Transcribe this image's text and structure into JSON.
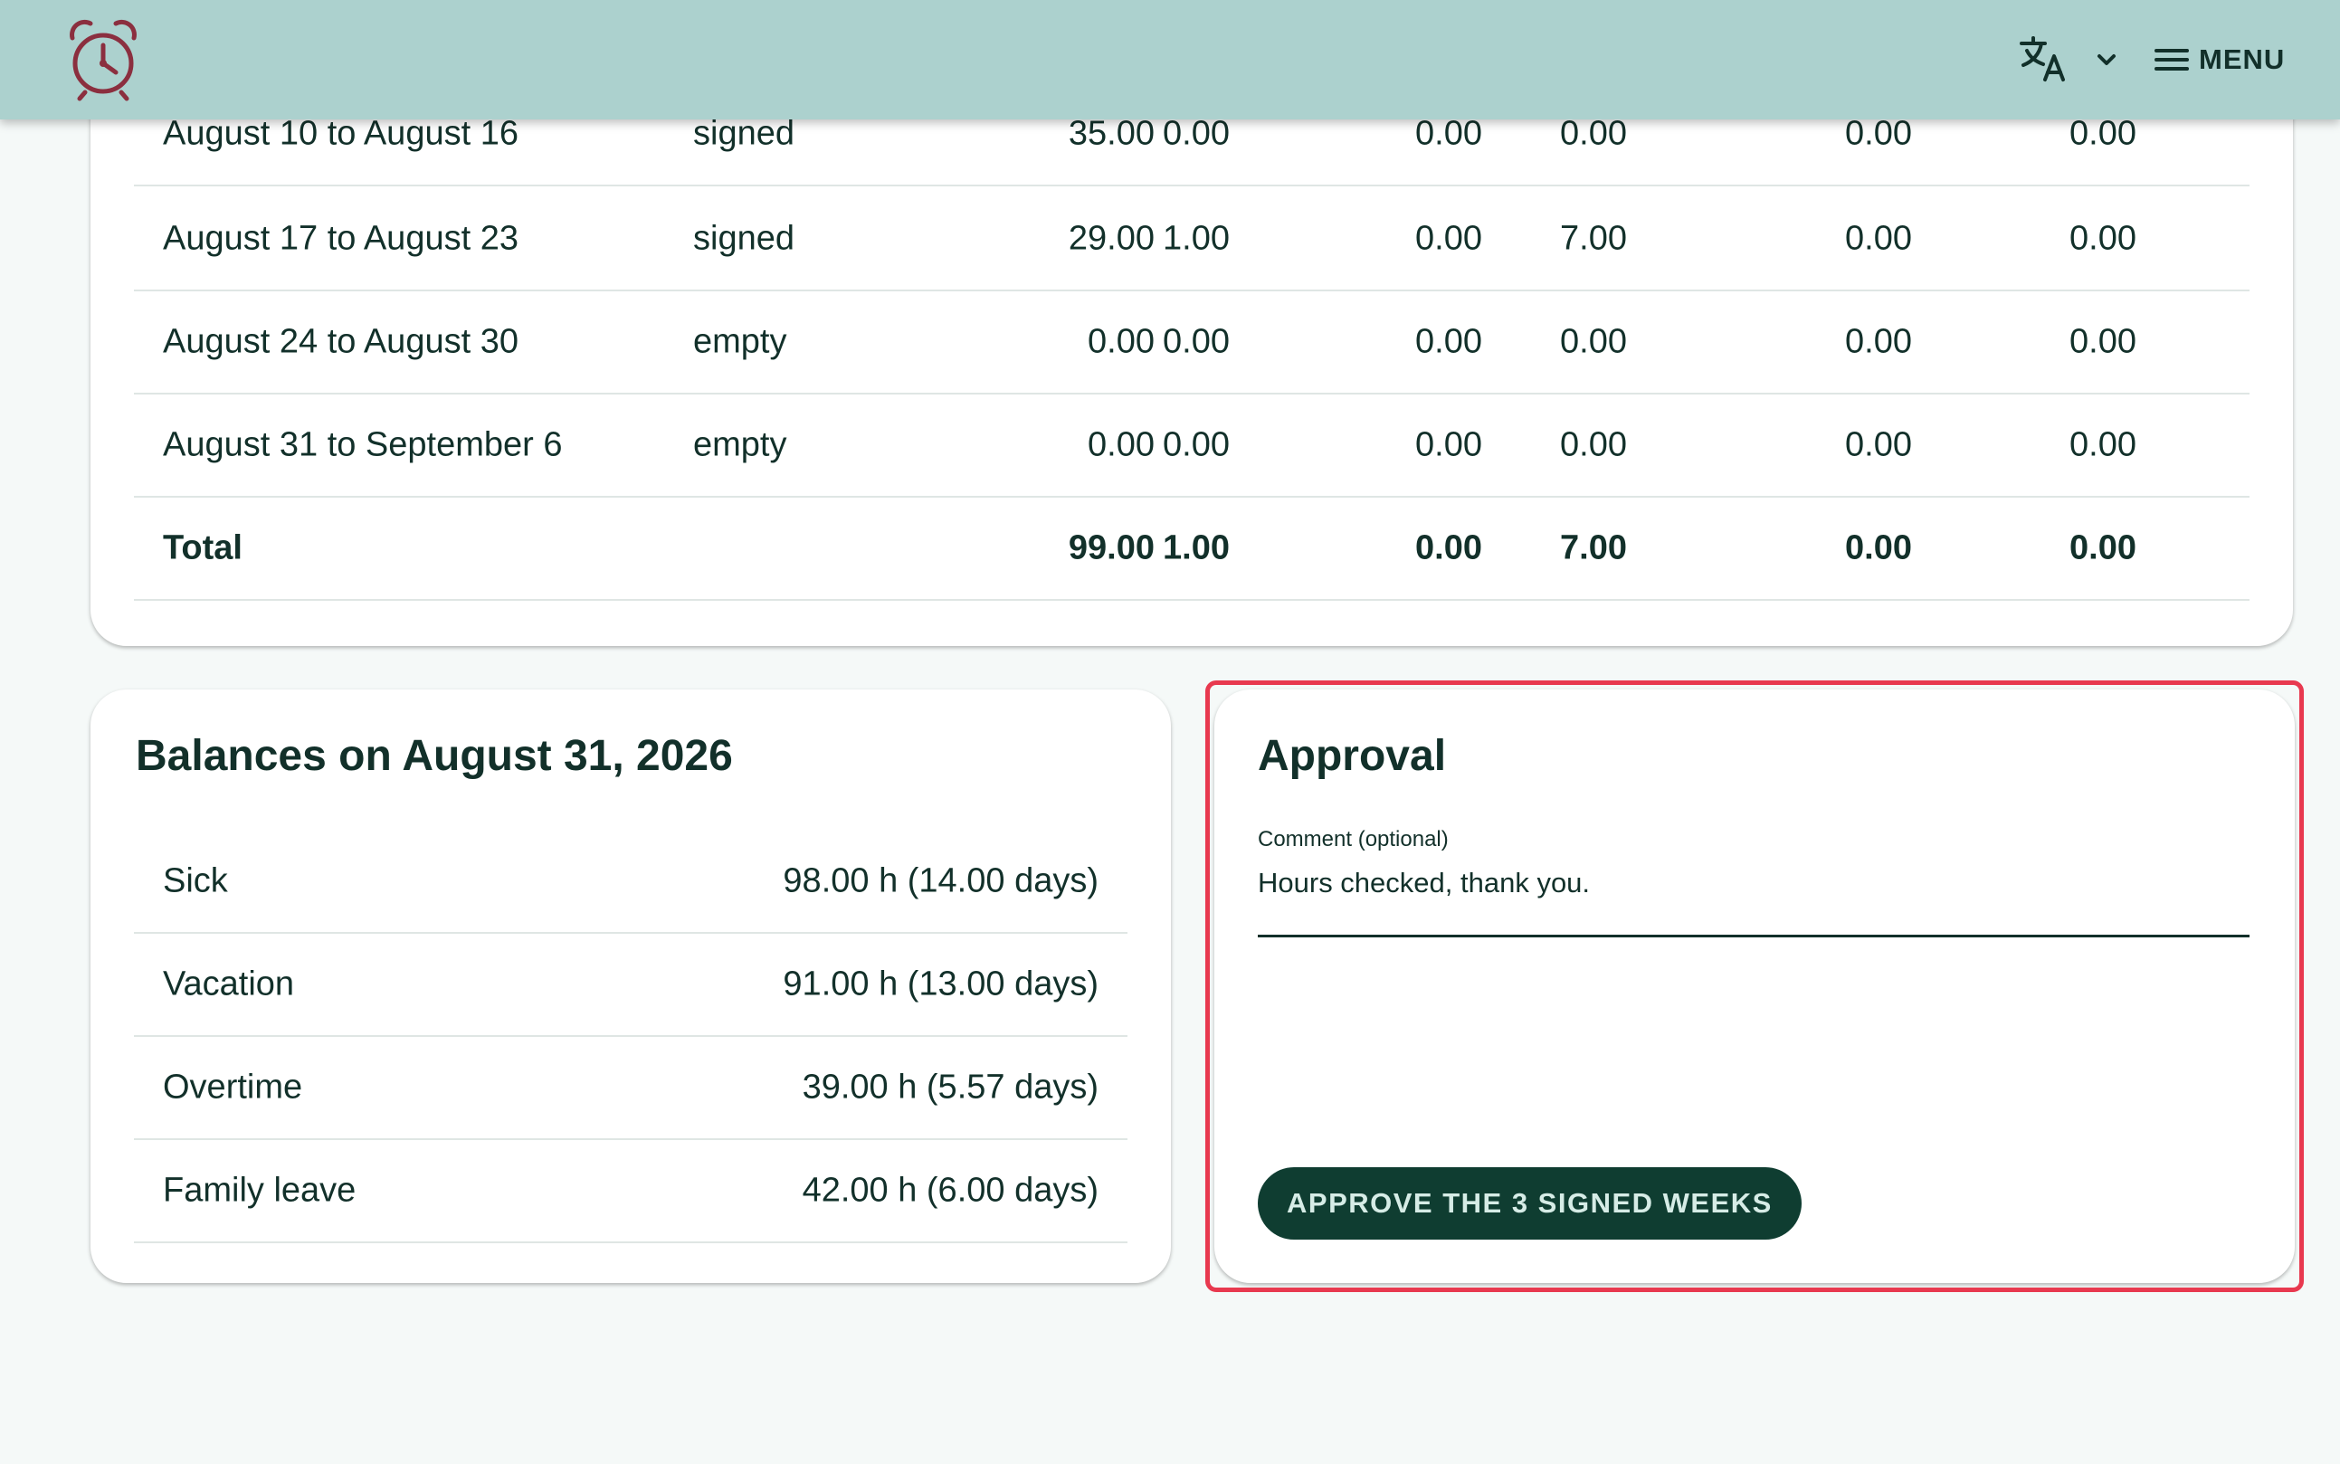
{
  "header": {
    "logo_icon": "alarm-clock-icon",
    "language_icon": "translate-icon",
    "menu_label": "MENU",
    "colors": {
      "header_bg": "#acd1ce",
      "text": "#12302a"
    }
  },
  "weeks": {
    "rows": [
      {
        "label": "August 10 to August 16",
        "status": "signed",
        "v1": "35.00",
        "v2": "0.00",
        "v3": "0.00",
        "v4": "0.00",
        "v5": "0.00",
        "v6": "0.00"
      },
      {
        "label": "August 17 to August 23",
        "status": "signed",
        "v1": "29.00",
        "v2": "1.00",
        "v3": "0.00",
        "v4": "7.00",
        "v5": "0.00",
        "v6": "0.00"
      },
      {
        "label": "August 24 to August 30",
        "status": "empty",
        "v1": "0.00",
        "v2": "0.00",
        "v3": "0.00",
        "v4": "0.00",
        "v5": "0.00",
        "v6": "0.00"
      },
      {
        "label": "August 31 to September 6",
        "status": "empty",
        "v1": "0.00",
        "v2": "0.00",
        "v3": "0.00",
        "v4": "0.00",
        "v5": "0.00",
        "v6": "0.00"
      }
    ],
    "total": {
      "label": "Total",
      "v1": "99.00",
      "v2": "1.00",
      "v3": "0.00",
      "v4": "7.00",
      "v5": "0.00",
      "v6": "0.00"
    }
  },
  "balances": {
    "title": "Balances on August 31, 2026",
    "items": [
      {
        "label": "Sick",
        "value": "98.00 h (14.00 days)"
      },
      {
        "label": "Vacation",
        "value": "91.00 h (13.00 days)"
      },
      {
        "label": "Overtime",
        "value": "39.00 h (5.57 days)"
      },
      {
        "label": "Family leave",
        "value": "42.00 h (6.00 days)"
      }
    ]
  },
  "approval": {
    "title": "Approval",
    "comment_label": "Comment (optional)",
    "comment_value": "Hours checked, thank you.",
    "approve_label": "APPROVE THE 3 SIGNED WEEKS",
    "colors": {
      "button_bg": "#0f3d31",
      "highlight": "#e8394f"
    }
  }
}
